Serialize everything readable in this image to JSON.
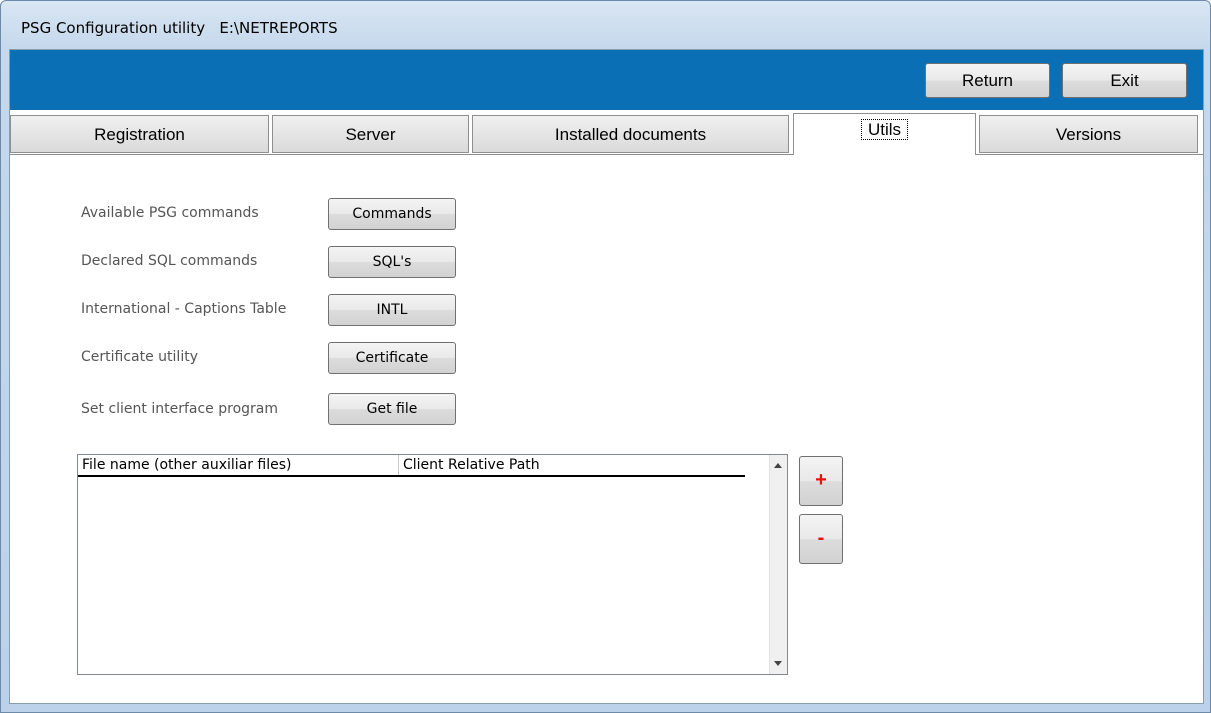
{
  "window": {
    "title": "PSG Configuration utility   E:\\NETREPORTS"
  },
  "toolbar": {
    "return_label": "Return",
    "exit_label": "Exit"
  },
  "tabs": [
    {
      "label": "Registration"
    },
    {
      "label": "Server"
    },
    {
      "label": "Installed documents"
    },
    {
      "label": "Utils",
      "active": true
    },
    {
      "label": "Versions"
    }
  ],
  "utils": {
    "rows": [
      {
        "label": "Available PSG commands",
        "button": "Commands"
      },
      {
        "label": "Declared SQL commands",
        "button": "SQL's"
      },
      {
        "label": "International - Captions Table",
        "button": "INTL"
      },
      {
        "label": "Certificate utility",
        "button": "Certificate"
      },
      {
        "label": "Set client interface program",
        "button": "Get file"
      }
    ]
  },
  "files_table": {
    "columns": [
      "File name (other auxiliar files)",
      "Client Relative Path"
    ],
    "rows": []
  },
  "side_buttons": {
    "add": "+",
    "remove": "-"
  },
  "colors": {
    "header_bar": "#0a6fb5",
    "plus_minus": "#e81010"
  }
}
